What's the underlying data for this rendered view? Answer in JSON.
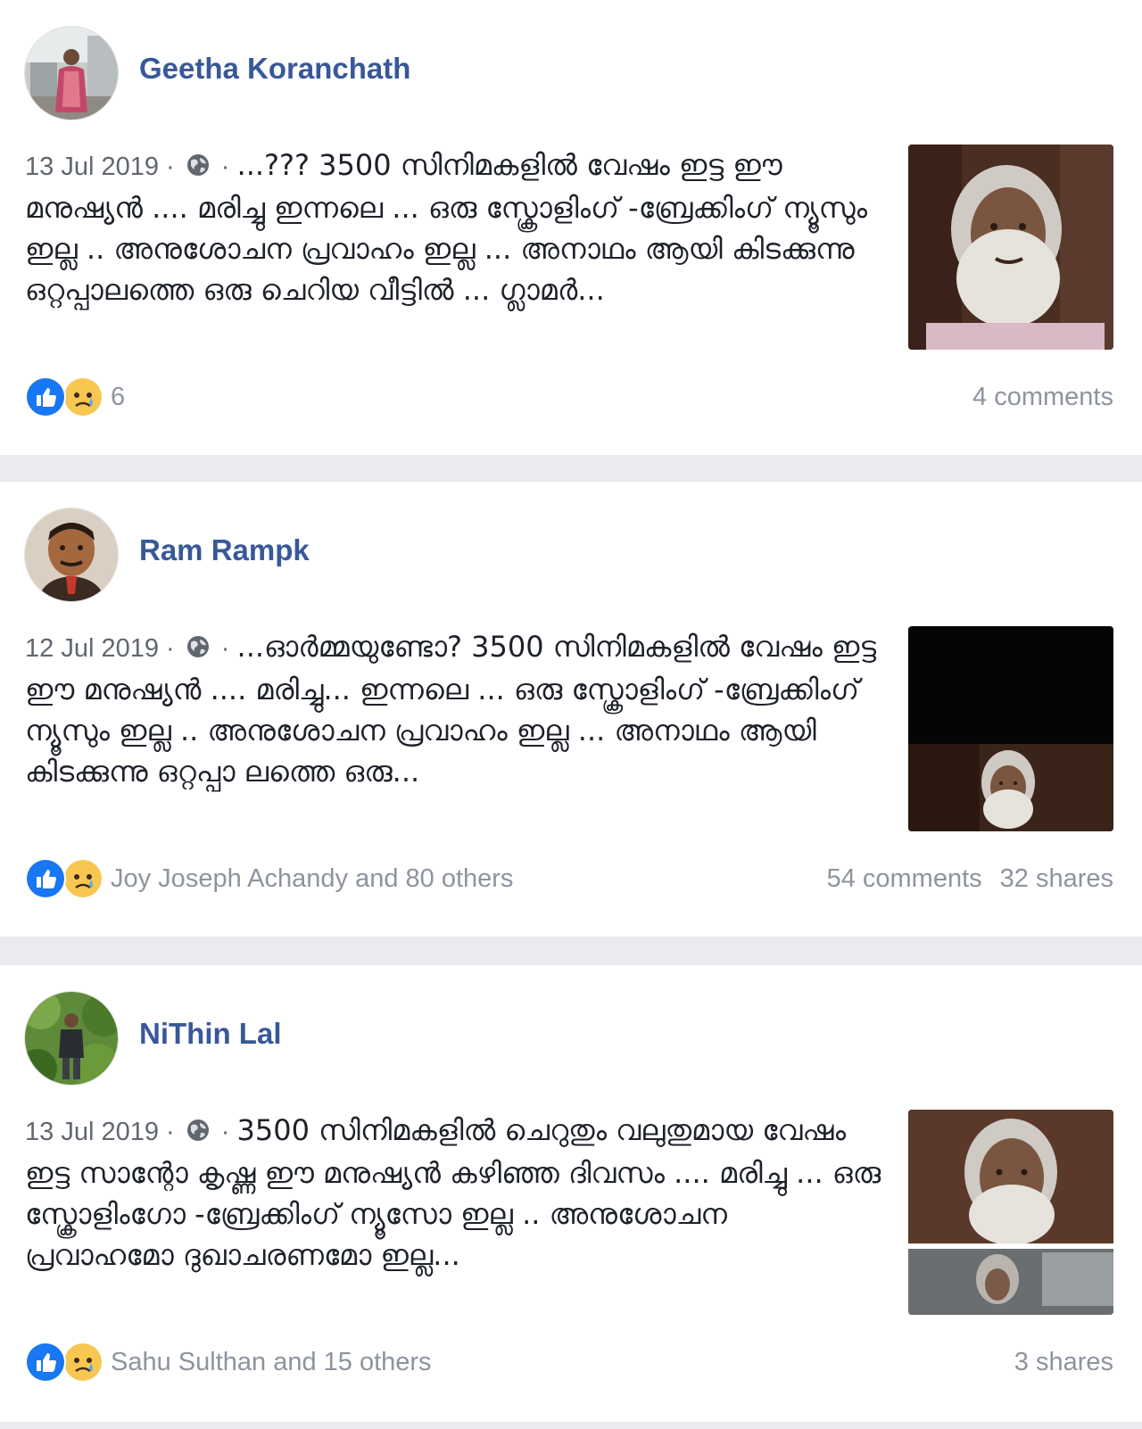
{
  "colors": {
    "author_link": "#385898",
    "meta_text": "#616770",
    "muted_text": "#8d949e",
    "like_blue": "#1877f2",
    "sad_yellow": "#f7c752",
    "feed_bg": "#e9ebee"
  },
  "icons": {
    "privacy": "globe-icon",
    "like": "like-reaction-icon",
    "sad": "sad-reaction-icon"
  },
  "posts": [
    {
      "author": "Geetha Koranchath",
      "date": "13 Jul 2019",
      "separator": " · ",
      "text": "...??? 3500 സിനിമകളിൽ വേഷം ഇട്ട ഈ മനുഷ്യൻ .... മരിച്ചു ഇന്നലെ ... ഒരു സ്ക്രോളിംഗ് -ബ്രേക്കിംഗ് ന്യൂസും ഇല്ല .. അനുശോചന പ്രവാഹം ഇല്ല ... അനാഥം ആയി കിടക്കുന്നു ഒറ്റപ്പാലത്തെ ഒരു ചെറിയ വീട്ടിൽ ... ഗ്ലാമർ...",
      "reactions_count": "6",
      "comments": "4 comments",
      "shares": ""
    },
    {
      "author": "Ram Rampk",
      "date": "12 Jul 2019",
      "separator": " · ",
      "text": "...ഓർമ്മയുണ്ടോ? 3500 സിനിമകളിൽ വേഷം ഇട്ട ഈ മനുഷ്യൻ .... മരിച്ചു... ഇന്നലെ ... ഒരു സ്ക്രോളിംഗ് -ബ്രേക്കിംഗ് ന്യൂസും ഇല്ല .. അനുശോചന പ്രവാഹം ഇല്ല ... അനാഥം ആയി കിടക്കുന്നു ഒറ്റപ്പാ ലത്തെ ഒരു...",
      "reactions_count": "Joy Joseph Achandy and 80 others",
      "comments": "54 comments",
      "shares": "32 shares"
    },
    {
      "author": "NiThin Lal",
      "date": "13 Jul 2019",
      "separator": " · ",
      "text": "3500 സിനിമകളിൽ ചെറുതും വലുതുമായ വേഷം ഇട്ട സാന്റോ കൃഷ്ണ ഈ മനുഷ്യൻ കഴിഞ്ഞ ദിവസം .... മരിച്ചു ... ഒരു സ്ക്രോളിംഗോ -ബ്രേക്കിംഗ് ന്യൂസോ ഇല്ല .. അനുശോചന പ്രവാഹമോ ദുഖാചരണമോ ഇല്ല...",
      "reactions_count": "Sahu Sulthan and 15 others",
      "comments": "",
      "shares": "3 shares"
    }
  ]
}
